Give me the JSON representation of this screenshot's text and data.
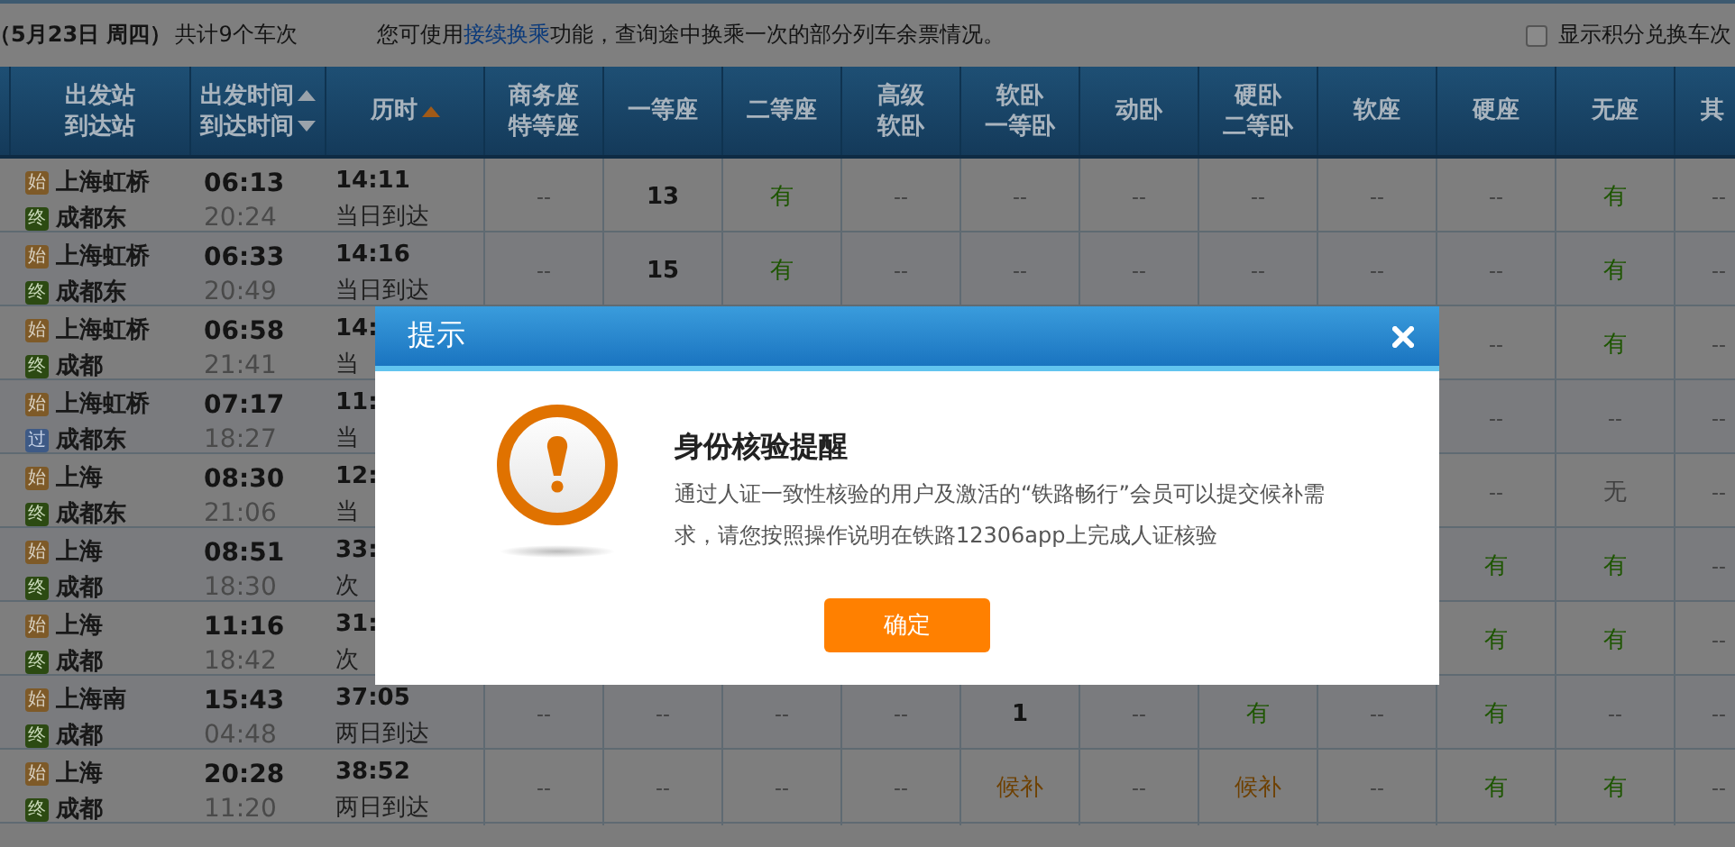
{
  "top_bar": {
    "date": "（5月23日  周四）",
    "count": "共计9个车次",
    "notice_before": "您可使用",
    "notice_link": "接续换乘",
    "notice_after": "功能，查询途中换乘一次的部分列车余票情况。",
    "show_points": {
      "label": "显示积分兑换车次",
      "checked": false
    }
  },
  "table": {
    "columns": [
      {
        "lines": [
          "出发站",
          "到达站"
        ]
      },
      {
        "lines": [
          "出发时间",
          "到达时间"
        ],
        "sortable": true,
        "sorted": false
      },
      {
        "lines": [
          "历时"
        ],
        "sortable": true,
        "sorted": true
      },
      {
        "lines": [
          "商务座",
          "特等座"
        ]
      },
      {
        "lines": [
          "一等座"
        ]
      },
      {
        "lines": [
          "二等座"
        ]
      },
      {
        "lines": [
          "高级",
          "软卧"
        ]
      },
      {
        "lines": [
          "软卧",
          "一等卧"
        ]
      },
      {
        "lines": [
          "动卧"
        ]
      },
      {
        "lines": [
          "硬卧",
          "二等卧"
        ]
      },
      {
        "lines": [
          "软座"
        ]
      },
      {
        "lines": [
          "硬座"
        ]
      },
      {
        "lines": [
          "无座"
        ]
      },
      {
        "lines": [
          "其"
        ]
      }
    ],
    "rows": [
      {
        "from": {
          "badge": "始",
          "kind": "start",
          "name": "上海虹桥"
        },
        "to": {
          "badge": "终",
          "kind": "end",
          "name": "成都东"
        },
        "depart": "06:13",
        "arrive": "20:24",
        "duration": "14:11",
        "arrival_day": "当日到达",
        "seats": [
          {
            "text": "--",
            "kind": "none"
          },
          {
            "text": "13",
            "kind": "count"
          },
          {
            "text": "有",
            "kind": "available"
          },
          {
            "text": "--",
            "kind": "none"
          },
          {
            "text": "--",
            "kind": "none"
          },
          {
            "text": "--",
            "kind": "none"
          },
          {
            "text": "--",
            "kind": "none"
          },
          {
            "text": "--",
            "kind": "none"
          },
          {
            "text": "--",
            "kind": "none"
          },
          {
            "text": "有",
            "kind": "available"
          },
          {
            "text": "--",
            "kind": "none"
          }
        ]
      },
      {
        "from": {
          "badge": "始",
          "kind": "start",
          "name": "上海虹桥"
        },
        "to": {
          "badge": "终",
          "kind": "end",
          "name": "成都东"
        },
        "depart": "06:33",
        "arrive": "20:49",
        "duration": "14:16",
        "arrival_day": "当日到达",
        "seats": [
          {
            "text": "--",
            "kind": "none"
          },
          {
            "text": "15",
            "kind": "count"
          },
          {
            "text": "有",
            "kind": "available"
          },
          {
            "text": "--",
            "kind": "none"
          },
          {
            "text": "--",
            "kind": "none"
          },
          {
            "text": "--",
            "kind": "none"
          },
          {
            "text": "--",
            "kind": "none"
          },
          {
            "text": "--",
            "kind": "none"
          },
          {
            "text": "--",
            "kind": "none"
          },
          {
            "text": "有",
            "kind": "available"
          },
          {
            "text": "--",
            "kind": "none"
          }
        ]
      },
      {
        "from": {
          "badge": "始",
          "kind": "start",
          "name": "上海虹桥"
        },
        "to": {
          "badge": "终",
          "kind": "end",
          "name": "成都"
        },
        "depart": "06:58",
        "arrive": "21:41",
        "duration": "14:",
        "arrival_day": "当",
        "seats": [
          {
            "text": "--",
            "kind": "none"
          },
          {
            "text": "有",
            "kind": "available"
          },
          {
            "text": "--",
            "kind": "none"
          }
        ]
      },
      {
        "from": {
          "badge": "始",
          "kind": "start",
          "name": "上海虹桥"
        },
        "to": {
          "badge": "过",
          "kind": "pass",
          "name": "成都东"
        },
        "depart": "07:17",
        "arrive": "18:27",
        "duration": "11:",
        "arrival_day": "当",
        "seats": [
          {
            "text": "--",
            "kind": "none"
          },
          {
            "text": "--",
            "kind": "none"
          },
          {
            "text": "--",
            "kind": "none"
          }
        ]
      },
      {
        "from": {
          "badge": "始",
          "kind": "start",
          "name": "上海"
        },
        "to": {
          "badge": "终",
          "kind": "end",
          "name": "成都东"
        },
        "depart": "08:30",
        "arrive": "21:06",
        "duration": "12:",
        "arrival_day": "当",
        "seats": [
          {
            "text": "--",
            "kind": "none"
          },
          {
            "text": "无",
            "kind": "soldout"
          },
          {
            "text": "--",
            "kind": "none"
          }
        ]
      },
      {
        "from": {
          "badge": "始",
          "kind": "start",
          "name": "上海"
        },
        "to": {
          "badge": "终",
          "kind": "end",
          "name": "成都"
        },
        "depart": "08:51",
        "arrive": "18:30",
        "duration": "33:",
        "arrival_day": "次",
        "seats": [
          {
            "text": "有",
            "kind": "available"
          },
          {
            "text": "有",
            "kind": "available"
          },
          {
            "text": "--",
            "kind": "none"
          }
        ]
      },
      {
        "from": {
          "badge": "始",
          "kind": "start",
          "name": "上海"
        },
        "to": {
          "badge": "终",
          "kind": "end",
          "name": "成都"
        },
        "depart": "11:16",
        "arrive": "18:42",
        "duration": "31:",
        "arrival_day": "次",
        "seats": [
          {
            "text": "有",
            "kind": "available"
          },
          {
            "text": "有",
            "kind": "available"
          },
          {
            "text": "--",
            "kind": "none"
          }
        ]
      },
      {
        "from": {
          "badge": "始",
          "kind": "start",
          "name": "上海南"
        },
        "to": {
          "badge": "终",
          "kind": "end",
          "name": "成都"
        },
        "depart": "15:43",
        "arrive": "04:48",
        "duration": "37:05",
        "arrival_day": "两日到达",
        "seats": [
          {
            "text": "--",
            "kind": "none"
          },
          {
            "text": "--",
            "kind": "none"
          },
          {
            "text": "--",
            "kind": "none"
          },
          {
            "text": "--",
            "kind": "none"
          },
          {
            "text": "1",
            "kind": "count"
          },
          {
            "text": "--",
            "kind": "none"
          },
          {
            "text": "有",
            "kind": "available"
          },
          {
            "text": "--",
            "kind": "none"
          },
          {
            "text": "有",
            "kind": "available"
          },
          {
            "text": "--",
            "kind": "none"
          },
          {
            "text": "--",
            "kind": "none"
          }
        ]
      },
      {
        "from": {
          "badge": "始",
          "kind": "start",
          "name": "上海"
        },
        "to": {
          "badge": "终",
          "kind": "end",
          "name": "成都"
        },
        "depart": "20:28",
        "arrive": "11:20",
        "duration": "38:52",
        "arrival_day": "两日到达",
        "seats": [
          {
            "text": "--",
            "kind": "none"
          },
          {
            "text": "--",
            "kind": "none"
          },
          {
            "text": "--",
            "kind": "none"
          },
          {
            "text": "--",
            "kind": "none"
          },
          {
            "text": "候补",
            "kind": "waitlist"
          },
          {
            "text": "--",
            "kind": "none"
          },
          {
            "text": "候补",
            "kind": "waitlist"
          },
          {
            "text": "--",
            "kind": "none"
          },
          {
            "text": "有",
            "kind": "available"
          },
          {
            "text": "有",
            "kind": "available"
          },
          {
            "text": "--",
            "kind": "none"
          }
        ]
      }
    ]
  },
  "dialog": {
    "title": "提示",
    "heading": "身份核验提醒",
    "message": "通过人证一致性核验的用户及激活的“铁路畅行”会员可以提交候补需求，请您按照操作说明在铁路12306app上完成人证核验",
    "button": "确定"
  }
}
